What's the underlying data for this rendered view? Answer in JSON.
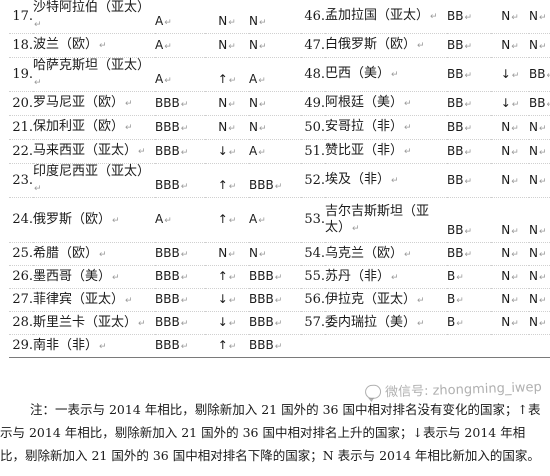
{
  "table": {
    "rows": [
      {
        "l": {
          "num": "17.",
          "name": "沙特阿拉伯（亚太）",
          "rating": "A",
          "change": "N",
          "prev": "N",
          "tall": true
        },
        "r": {
          "num": "46.",
          "name": "孟加拉国（亚太）",
          "rating": "BB",
          "change": "N",
          "prev": "N",
          "tall": false
        }
      },
      {
        "l": {
          "num": "18.",
          "name": "波兰（欧）",
          "rating": "A",
          "change": "N",
          "prev": "N"
        },
        "r": {
          "num": "47.",
          "name": "白俄罗斯（欧）",
          "rating": "BB",
          "change": "N",
          "prev": "N"
        }
      },
      {
        "l": {
          "num": "19.",
          "name": "哈萨克斯坦（亚太）",
          "rating": "A",
          "change": "↑",
          "prev": "A",
          "tall": true
        },
        "r": {
          "num": "48.",
          "name": "巴西（美）",
          "rating": "BB",
          "change": "↓",
          "prev": "BB"
        }
      },
      {
        "l": {
          "num": "20.",
          "name": "罗马尼亚（欧）",
          "rating": "BBB",
          "change": "N",
          "prev": "N"
        },
        "r": {
          "num": "49.",
          "name": "阿根廷（美）",
          "rating": "BB",
          "change": "↓",
          "prev": "BB"
        }
      },
      {
        "l": {
          "num": "21.",
          "name": "保加利亚（欧）",
          "rating": "BBB",
          "change": "N",
          "prev": "N"
        },
        "r": {
          "num": "50.",
          "name": "安哥拉（非）",
          "rating": "BB",
          "change": "N",
          "prev": "N"
        }
      },
      {
        "l": {
          "num": "22.",
          "name": "马来西亚（亚太）",
          "rating": "BBB",
          "change": "↓",
          "prev": "A"
        },
        "r": {
          "num": "51.",
          "name": "赞比亚（非）",
          "rating": "BB",
          "change": "N",
          "prev": "N"
        }
      },
      {
        "l": {
          "num": "23.",
          "name": "印度尼西亚（亚太）",
          "rating": "BBB",
          "change": "↑",
          "prev": "BBB",
          "tall": true
        },
        "r": {
          "num": "52.",
          "name": "埃及（非）",
          "rating": "BB",
          "change": "N",
          "prev": "N"
        }
      },
      {
        "l": {
          "num": "24.",
          "name": "俄罗斯（欧）",
          "rating": "A",
          "change": "↑",
          "prev": "A"
        },
        "r": {
          "num": "53.",
          "name": "吉尔吉斯斯坦（亚太）",
          "rating": "BB",
          "change": "N",
          "prev": "N",
          "tall": true
        }
      },
      {
        "l": {
          "num": "25.",
          "name": "希腊（欧）",
          "rating": "BBB",
          "change": "N",
          "prev": "N"
        },
        "r": {
          "num": "54.",
          "name": "乌克兰（欧）",
          "rating": "BB",
          "change": "N",
          "prev": "N"
        }
      },
      {
        "l": {
          "num": "26.",
          "name": "墨西哥（美）",
          "rating": "BBB",
          "change": "↑",
          "prev": "BBB"
        },
        "r": {
          "num": "55.",
          "name": "苏丹（非）",
          "rating": "B",
          "change": "N",
          "prev": "N"
        }
      },
      {
        "l": {
          "num": "27.",
          "name": "菲律宾（亚太）",
          "rating": "BBB",
          "change": "↓",
          "prev": "BBB"
        },
        "r": {
          "num": "56.",
          "name": "伊拉克（亚太）",
          "rating": "B",
          "change": "N",
          "prev": "N"
        }
      },
      {
        "l": {
          "num": "28.",
          "name": "斯里兰卡（亚太）",
          "rating": "BBB",
          "change": "↓",
          "prev": "BBB"
        },
        "r": {
          "num": "57.",
          "name": "委内瑞拉（美）",
          "rating": "B",
          "change": "N",
          "prev": "N"
        }
      },
      {
        "l": {
          "num": "29.",
          "name": "南非（非）",
          "rating": "BBB",
          "change": "↑",
          "prev": "BBB"
        },
        "r": {
          "num": "",
          "name": "",
          "rating": "",
          "change": "",
          "prev": ""
        }
      }
    ]
  },
  "note": "注：一表示与 2014 年相比，剔除新加入 21 国外的 36 国中相对排名没有变化的国家；↑表示与 2014 年相比，剔除新加入 21 国外的 36 国中相对排名上升的国家；↓表示与 2014 年相比，剔除新加入 21 国外的 36 国中相对排名下降的国家；N 表示与 2014 年相比新加入的国家。",
  "watermark": "微信号: zhongming_iwep"
}
